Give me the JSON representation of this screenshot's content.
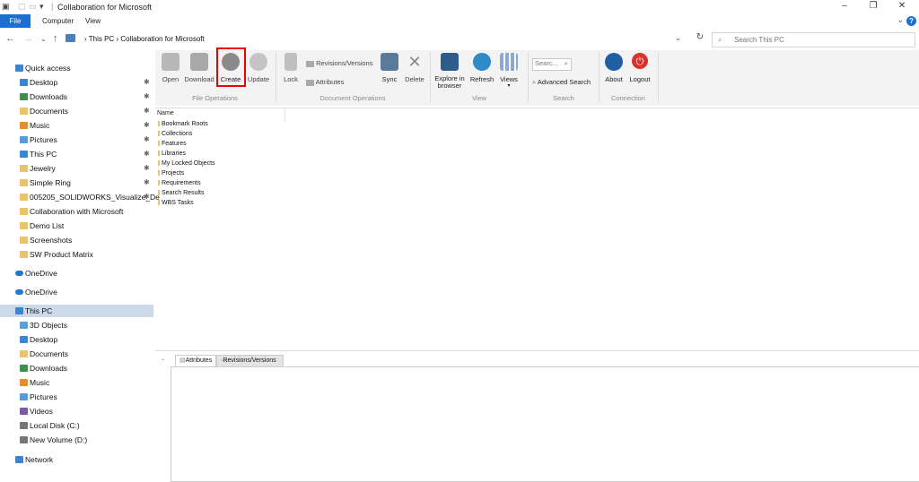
{
  "window": {
    "title": "Collaboration for Microsoft",
    "controls": {
      "minimize": "–",
      "maximize": "❐",
      "close": "✕"
    }
  },
  "menu": {
    "file": "File",
    "tabs": [
      "Computer",
      "View"
    ],
    "help": "?"
  },
  "address": {
    "path": [
      "This PC",
      "Collaboration for Microsoft"
    ],
    "separator": "›",
    "search_placeholder": "Search This PC"
  },
  "nav": {
    "quick_access": "Quick access",
    "quick_items": [
      {
        "label": "Desktop",
        "pinned": true,
        "color": "#3a86d6"
      },
      {
        "label": "Downloads",
        "pinned": true,
        "color": "#3f8f4c"
      },
      {
        "label": "Documents",
        "pinned": true,
        "color": "#e8c56a"
      },
      {
        "label": "Music",
        "pinned": true,
        "color": "#e09030"
      },
      {
        "label": "Pictures",
        "pinned": true,
        "color": "#5b9bd5"
      },
      {
        "label": "This PC",
        "pinned": true,
        "color": "#3a86d6"
      },
      {
        "label": "Jewelry",
        "pinned": true,
        "color": "#e8c56a"
      },
      {
        "label": "Simple Ring",
        "pinned": true,
        "color": "#e8c56a"
      },
      {
        "label": "005205_SOLIDWORKS_Visualize_De",
        "pinned": true,
        "color": "#e8c56a"
      },
      {
        "label": "Collaboration with Microsoft",
        "pinned": false,
        "color": "#e8c56a"
      },
      {
        "label": "Demo List",
        "pinned": false,
        "color": "#e8c56a"
      },
      {
        "label": "Screenshots",
        "pinned": false,
        "color": "#e8c56a"
      },
      {
        "label": "SW Product Matrix",
        "pinned": false,
        "color": "#e8c56a"
      }
    ],
    "onedrive_1": "OneDrive",
    "onedrive_2": "OneDrive",
    "this_pc": "This PC",
    "pc_items": [
      {
        "label": "3D Objects",
        "color": "#5aa0d8"
      },
      {
        "label": "Desktop",
        "color": "#3a86d6"
      },
      {
        "label": "Documents",
        "color": "#e8c56a"
      },
      {
        "label": "Downloads",
        "color": "#3f8f4c"
      },
      {
        "label": "Music",
        "color": "#e09030"
      },
      {
        "label": "Pictures",
        "color": "#5b9bd5"
      },
      {
        "label": "Videos",
        "color": "#7a5aa6"
      },
      {
        "label": "Local Disk (C:)",
        "color": "#777777"
      },
      {
        "label": "New Volume (D:)",
        "color": "#777777"
      }
    ],
    "network": "Network",
    "pin_glyph": "✱"
  },
  "ribbon": {
    "buttons": {
      "open": "Open",
      "download": "Download",
      "create": "Create",
      "update": "Update",
      "lock": "Lock",
      "revisions": "Revisions/Versions",
      "attributes": "Attributes",
      "sync": "Sync",
      "delete": "Delete",
      "explore_1": "Explore in",
      "explore_2": "browser",
      "refresh": "Refresh",
      "views": "Views",
      "search_placeholder": "Searc...",
      "advanced_search": "Advanced Search",
      "about": "About",
      "logout": "Logout"
    },
    "groups": {
      "file": "File Operations",
      "document": "Document Operations",
      "view": "View",
      "search": "Search",
      "connection": "Connection"
    },
    "colors": {
      "accent": "#1a6fcf",
      "highlight": "#e00000"
    }
  },
  "content": {
    "column_name": "Name",
    "items": [
      "Bookmark Roots",
      "Collections",
      "Features",
      "Libraries",
      "My Locked Objects",
      "Projects",
      "Requirements",
      "Search Results",
      "WBS Tasks"
    ]
  },
  "bottom": {
    "tabs": [
      "Attributes",
      "Revisions/Versions"
    ]
  }
}
